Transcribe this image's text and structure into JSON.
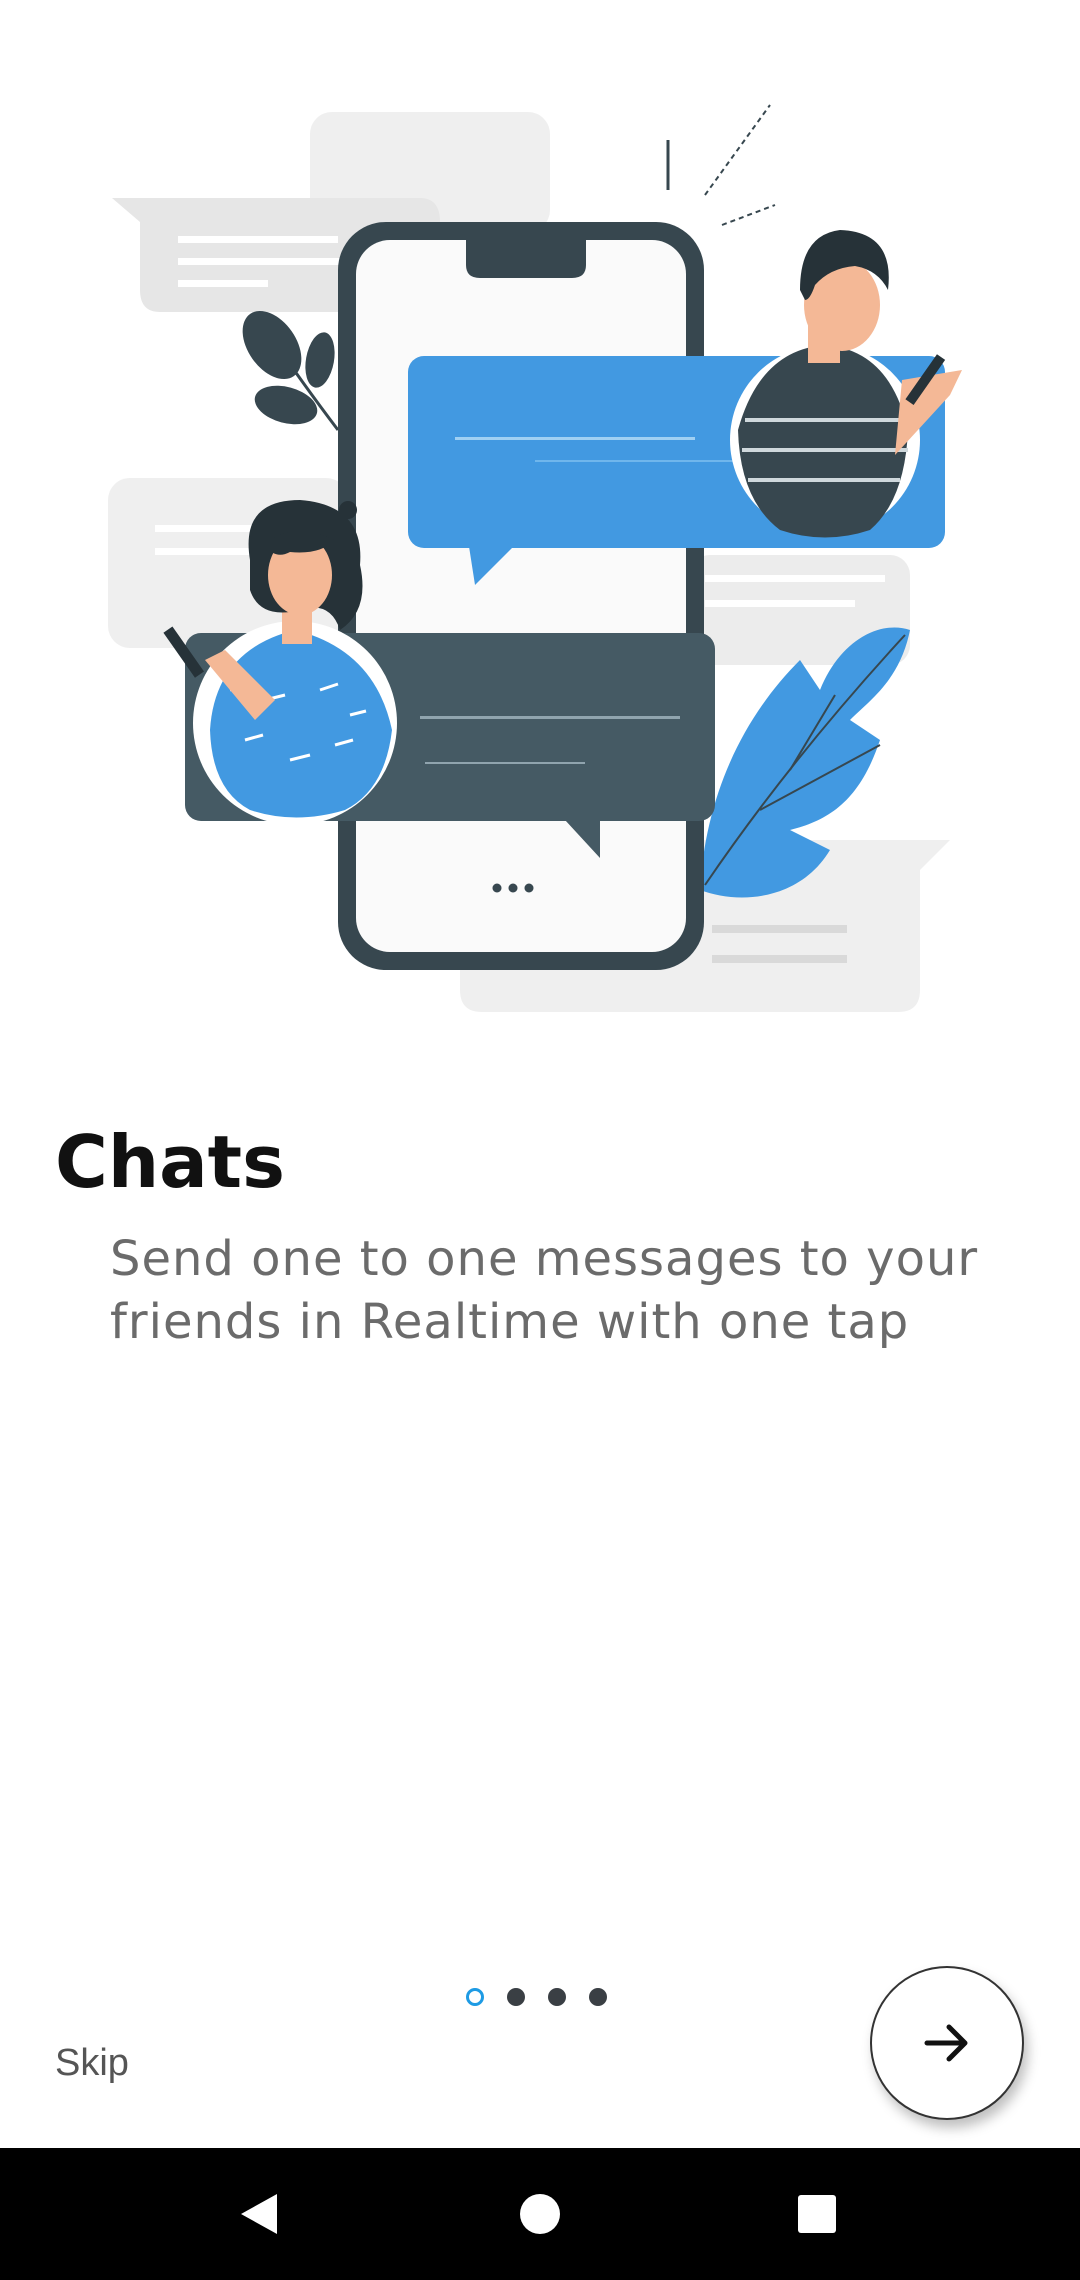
{
  "onboarding": {
    "title": "Chats",
    "description": "Send one to one messages to your friends in Realtime with one tap",
    "skip_label": "Skip",
    "pager": {
      "pages": 4,
      "active_index": 0
    }
  },
  "icons": {
    "next": "arrow-right-icon",
    "nav_back": "triangle-back-icon",
    "nav_home": "circle-home-icon",
    "nav_recents": "square-recents-icon"
  },
  "colors": {
    "accent": "#1e9be4",
    "bubble_blue": "#4299e1",
    "bubble_dark": "#455a64",
    "text_primary": "#111111",
    "text_secondary": "#6b6b6b",
    "nav_bar": "#000000"
  }
}
